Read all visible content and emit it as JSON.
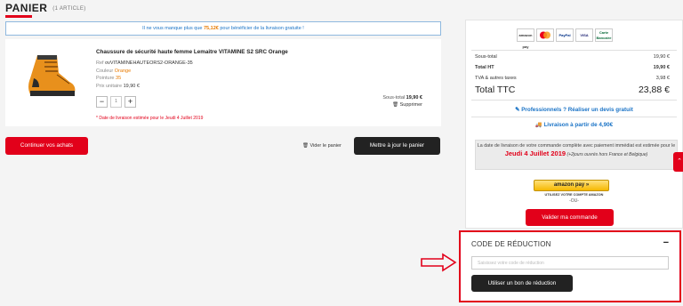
{
  "header": {
    "title": "PANIER",
    "count": "(1 ARTICLE)"
  },
  "banner": {
    "prefix": "Il ne vous manque plus que",
    "amount": "75,12€",
    "suffix": "pour bénéficier de la livraison gratuite !"
  },
  "product": {
    "name": "Chaussure de sécurité haute femme Lemaitre VITAMINE S2 SRC Orange",
    "ref_label": "Ref",
    "ref": "ovVITAMINEHAUTEORS2-ORANGE-35",
    "color_label": "Couleur",
    "color": "Orange",
    "size_label": "Pointure",
    "size": "35",
    "unit_price_label": "Prix unitaire",
    "unit_price": "19,90 €",
    "quantity": "1",
    "subtotal_label": "Sous-total",
    "subtotal": "19,90 €",
    "remove_label": "Supprimer",
    "delivery_estimate": "* Date de livraison estimée pour le Jeudi 4 Juillet 2019"
  },
  "actions": {
    "continue": "Continuer vos achats",
    "empty_cart": "Vider le panier",
    "update": "Mettre à jour le panier"
  },
  "summary": {
    "payment_logos": [
      "amazon pay",
      "Mastercard",
      "PayPal",
      "VISA",
      "Carte Bancaire"
    ],
    "rows": [
      {
        "label": "Sous-total",
        "value": "19,90 €"
      },
      {
        "label": "Total HT",
        "value": "19,90 €"
      },
      {
        "label": "TVA & autres taxes",
        "value": "3,98 €"
      },
      {
        "label": "Total TTC",
        "value": "23,88 €"
      }
    ],
    "pro_link": "Professionnels ? Réaliser un devis gratuit",
    "delivery_from": "Livraison à partir de 4,90€",
    "delivery_text": "La date de livraison de votre commande complète avec paiement immédiat est estimée pour le",
    "delivery_date": "Jeudi 4 Juillet 2019",
    "delivery_note": "(+2jours ouvrés hors France et Belgique)",
    "amazon_button": "amazon pay",
    "amazon_caption": "UTILISEZ VOTRE COMPTE AMAZON",
    "or": "-OU-",
    "validate": "Valider ma commande"
  },
  "promo": {
    "title": "CODE DE RÉDUCTION",
    "toggle": "−",
    "placeholder": "Saisissez votre code de réduction",
    "button": "Utiliser un bon de réduction"
  },
  "colors": {
    "accent": "#e2001a",
    "link": "#1a73c6",
    "dark": "#222222"
  }
}
